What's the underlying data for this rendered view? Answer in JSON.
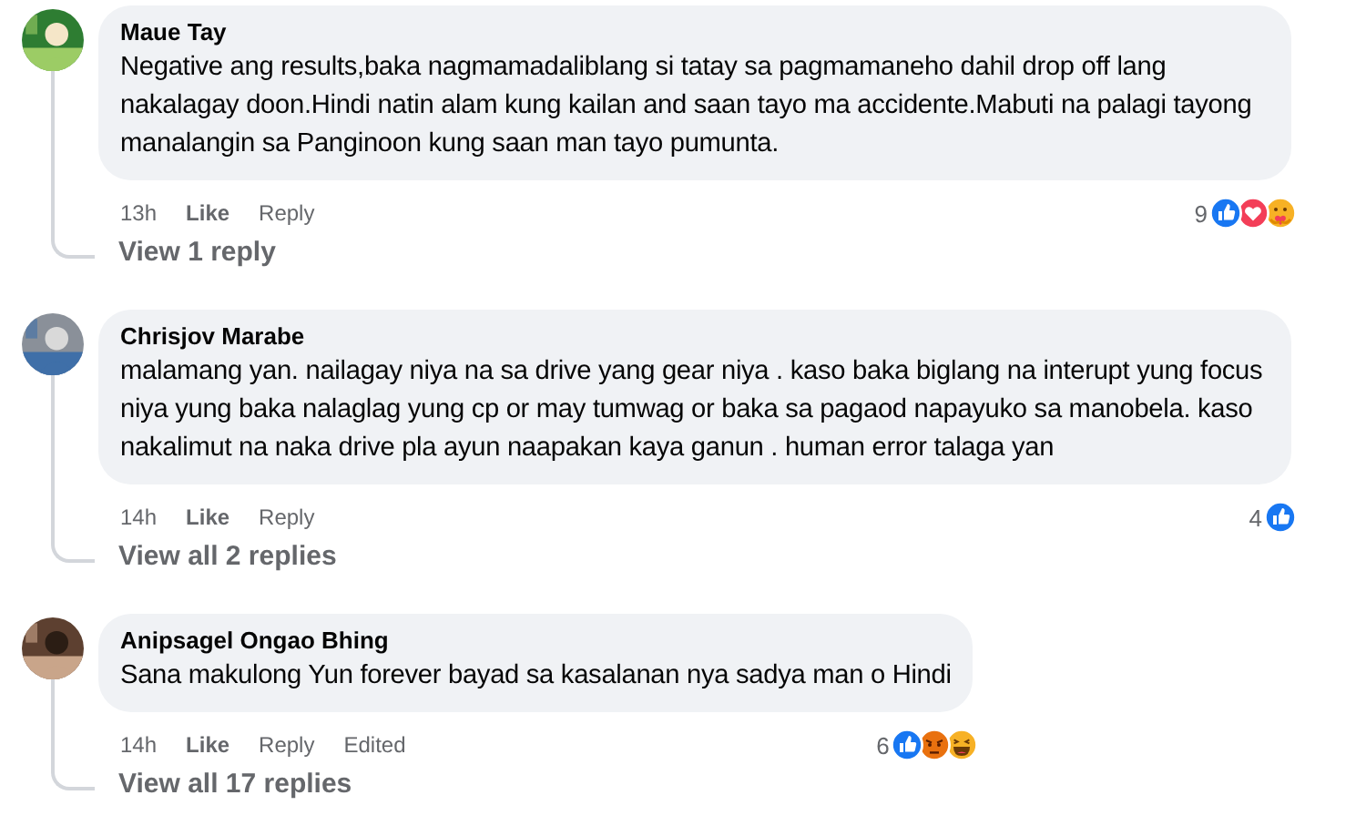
{
  "comments": [
    {
      "author": "Maue Tay",
      "avatar": {
        "kind": "picture"
      },
      "text": "Negative ang results,baka nagmamadaliblang si tatay sa pagmamaneho dahil drop off lang nakalagay doon.Hindi natin alam kung kailan and saan tayo ma accidente.Mabuti na palagi tayong manalangin sa Panginoon kung saan man tayo pumunta.",
      "time": "13h",
      "actions": [
        {
          "kind": "like",
          "label": "Like"
        },
        {
          "kind": "reply",
          "label": "Reply"
        }
      ],
      "reaction_count": "9",
      "reactions": [
        {
          "kind": "like"
        },
        {
          "kind": "love"
        },
        {
          "kind": "care"
        }
      ],
      "replies_link": "View 1 reply"
    },
    {
      "author": "Chrisjov Marabe",
      "avatar": {
        "kind": "picture"
      },
      "text": "malamang yan. nailagay niya na sa drive yang gear niya . kaso baka biglang na interupt yung focus niya yung baka nalaglag yung cp or may tumwag or baka sa pagaod napayuko sa manobela. kaso nakalimut na naka drive pla ayun naapakan kaya ganun . human error talaga yan",
      "time": "14h",
      "actions": [
        {
          "kind": "like",
          "label": "Like"
        },
        {
          "kind": "reply",
          "label": "Reply"
        }
      ],
      "reaction_count": "4",
      "reactions": [
        {
          "kind": "like"
        }
      ],
      "replies_link": "View all 2 replies"
    },
    {
      "author": "Anipsagel Ongao Bhing",
      "avatar": {
        "kind": "picture"
      },
      "text": "Sana makulong Yun forever bayad sa kasalanan nya sadya man o Hindi",
      "time": "14h",
      "actions": [
        {
          "kind": "like",
          "label": "Like"
        },
        {
          "kind": "reply",
          "label": "Reply"
        }
      ],
      "edited": "Edited",
      "reaction_count": "6",
      "reactions": [
        {
          "kind": "like"
        },
        {
          "kind": "angry"
        },
        {
          "kind": "haha"
        }
      ],
      "replies_link": "View all 17 replies"
    }
  ]
}
